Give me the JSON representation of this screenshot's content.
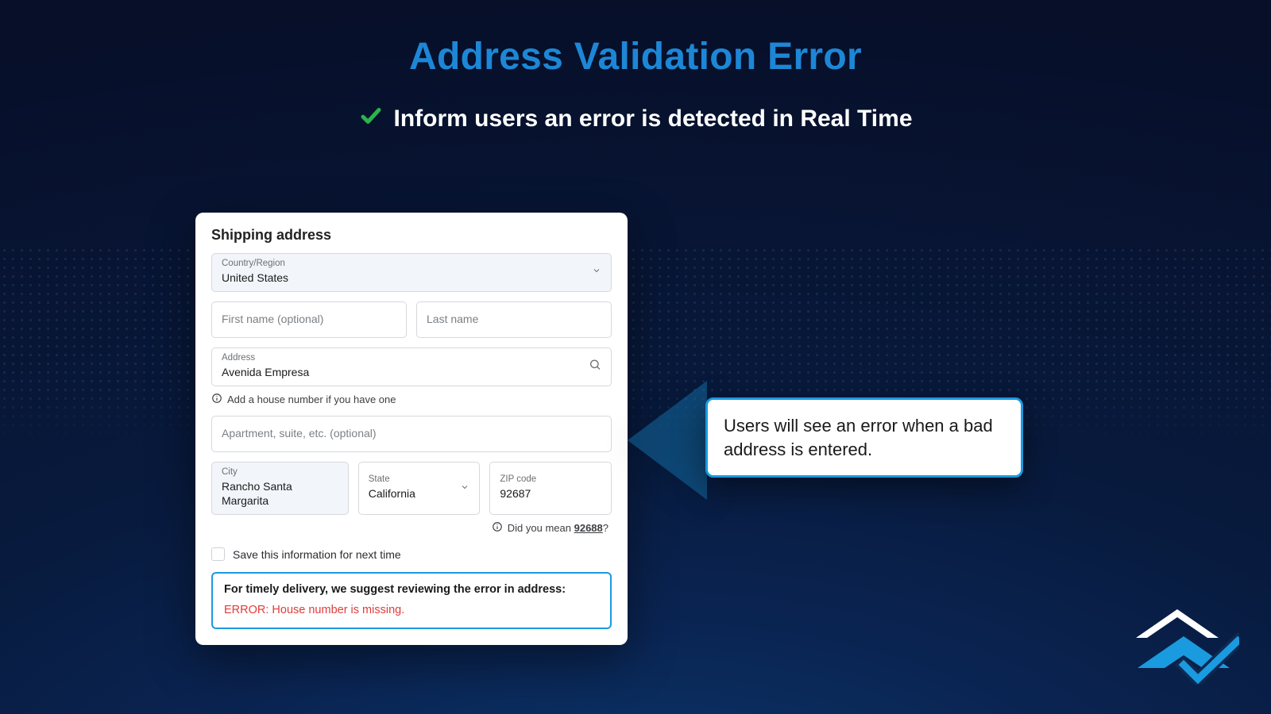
{
  "title": "Address Validation Error",
  "subtitle": "Inform users an error is detected in Real Time",
  "form": {
    "section_title": "Shipping address",
    "country": {
      "label": "Country/Region",
      "value": "United States"
    },
    "first_name": {
      "placeholder": "First name (optional)"
    },
    "last_name": {
      "placeholder": "Last name"
    },
    "address": {
      "label": "Address",
      "value": "Avenida Empresa"
    },
    "address_hint": "Add a house number if you have one",
    "apt": {
      "placeholder": "Apartment, suite, etc. (optional)"
    },
    "city": {
      "label": "City",
      "value": "Rancho Santa Margarita"
    },
    "state": {
      "label": "State",
      "value": "California"
    },
    "zip": {
      "label": "ZIP code",
      "value": "92687"
    },
    "zip_hint_prefix": "Did you mean ",
    "zip_hint_value": "92688",
    "zip_hint_suffix": "?",
    "save_label": "Save this information for next time",
    "error_lead": "For timely delivery, we suggest reviewing the error in address:",
    "error_text": "ERROR: House number is missing."
  },
  "callout": "Users will see an error when a bad address is entered."
}
